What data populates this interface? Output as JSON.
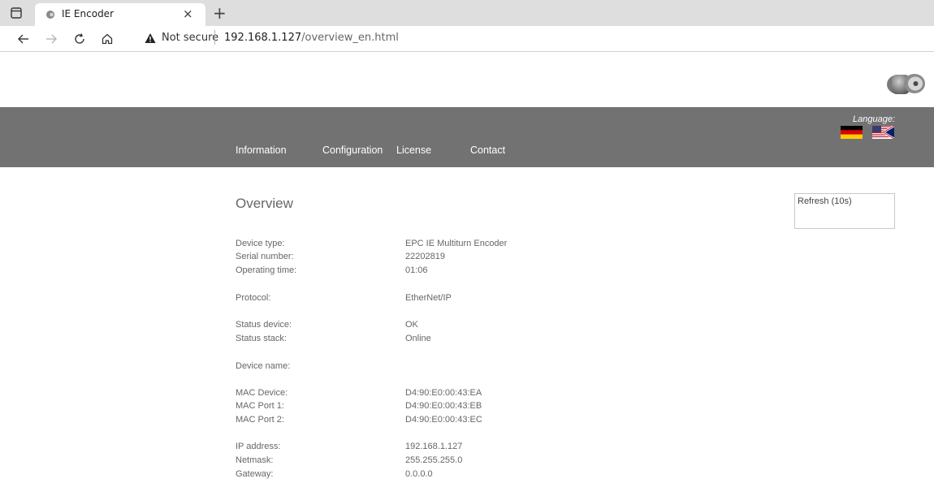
{
  "browser": {
    "tab_title": "IE Encoder",
    "close_glyph": "×",
    "new_tab_glyph": "+",
    "security_label": "Not secure",
    "url_host": "192.168.1.127",
    "url_path": "/overview_en.html",
    "icons": [
      "tab-menu-icon",
      "favicon-icon",
      "back-arrow-icon",
      "forward-arrow-icon",
      "reload-icon",
      "home-icon",
      "warning-icon"
    ]
  },
  "header": {
    "logo_icon": "encoder-logo-icon",
    "language_label": "Language:",
    "flags": [
      "flag-german-icon",
      "flag-english-icon"
    ],
    "nav": [
      "Information",
      "Configuration",
      "License",
      "Contact"
    ],
    "bar_color": "#727272"
  },
  "main": {
    "title": "Overview",
    "refresh_label": "Refresh (10s)",
    "rows": [
      {
        "label": "Device type:",
        "value": "EPC IE Multiturn Encoder"
      },
      {
        "label": "Serial number:",
        "value": "22202819"
      },
      {
        "label": "Operating time:",
        "value": "01:06"
      },
      {
        "label": "Protocol:",
        "value": "EtherNet/IP"
      },
      {
        "label": "Status device:",
        "value": "OK"
      },
      {
        "label": "Status stack:",
        "value": "Online"
      },
      {
        "label": "Device name:",
        "value": ""
      },
      {
        "label": "MAC Device:",
        "value": "D4:90:E0:00:43:EA"
      },
      {
        "label": "MAC Port 1:",
        "value": "D4:90:E0:00:43:EB"
      },
      {
        "label": "MAC Port 2:",
        "value": "D4:90:E0:00:43:EC"
      },
      {
        "label": "IP address:",
        "value": "192.168.1.127"
      },
      {
        "label": "Netmask:",
        "value": "255.255.255.0"
      },
      {
        "label": "Gateway:",
        "value": "0.0.0.0"
      }
    ]
  }
}
